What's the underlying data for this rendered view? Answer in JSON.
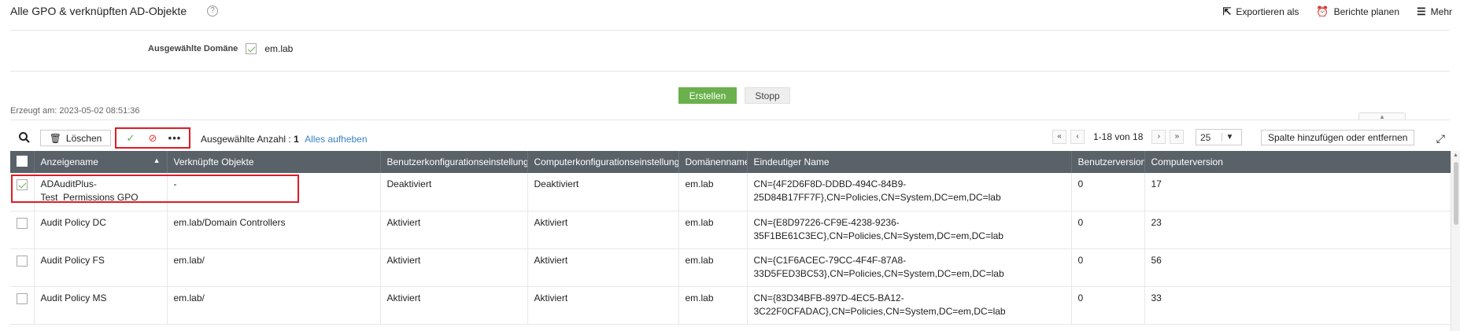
{
  "header": {
    "title": "Alle GPO & verknüpften AD-Objekte",
    "help_icon": "help-icon",
    "actions": [
      {
        "label": "Exportieren als",
        "icon": "export-icon"
      },
      {
        "label": "Berichte planen",
        "icon": "schedule-icon"
      },
      {
        "label": "Mehr",
        "icon": "more-menu-icon"
      }
    ]
  },
  "domain": {
    "label": "Ausgewählte Domäne",
    "value": "em.lab",
    "checked": true
  },
  "buttons": {
    "create": "Erstellen",
    "stop": "Stopp"
  },
  "generated": "Erzeugt am: 2023-05-02 08:51:36",
  "toolbar": {
    "delete": "Löschen",
    "selected_label": "Ausgewählte Anzahl :",
    "selected_count": "1",
    "clear_selection": "Alles aufheben",
    "page_info": "1-18 von 18",
    "page_size": "25",
    "columns_button": "Spalte hinzufügen oder entfernen"
  },
  "table": {
    "columns": [
      "Anzeigename",
      "Verknüpfte Objekte",
      "Benutzerkonfigurationseinstellungen",
      "Computerkonfigurationseinstellungen",
      "Domänenname",
      "Eindeutiger Name",
      "Benutzerversion",
      "Computerversion"
    ],
    "rows": [
      {
        "name": "ADAuditPlus-Test_Permissions GPO",
        "linked": "-",
        "user_cfg": "Deaktiviert",
        "comp_cfg": "Deaktiviert",
        "domain": "em.lab",
        "dn": "CN={4F2D6F8D-DDBD-494C-84B9-25D84B17FF7F},CN=Policies,CN=System,DC=em,DC=lab",
        "user_ver": "0",
        "comp_ver": "17",
        "checked": true
      },
      {
        "name": "Audit Policy DC",
        "linked": "em.lab/Domain Controllers",
        "user_cfg": "Aktiviert",
        "comp_cfg": "Aktiviert",
        "domain": "em.lab",
        "dn": "CN={E8D97226-CF9E-4238-9236-35F1BE61C3EC},CN=Policies,CN=System,DC=em,DC=lab",
        "user_ver": "0",
        "comp_ver": "23",
        "checked": false
      },
      {
        "name": "Audit Policy FS",
        "linked": "em.lab/",
        "user_cfg": "Aktiviert",
        "comp_cfg": "Aktiviert",
        "domain": "em.lab",
        "dn": "CN={C1F6ACEC-79CC-4F4F-87A8-33D5FED3BC53},CN=Policies,CN=System,DC=em,DC=lab",
        "user_ver": "0",
        "comp_ver": "56",
        "checked": false
      },
      {
        "name": "Audit Policy MS",
        "linked": "em.lab/",
        "user_cfg": "Aktiviert",
        "comp_cfg": "Aktiviert",
        "domain": "em.lab",
        "dn": "CN={83D34BFB-897D-4EC5-BA12-3C22F0CFADAC},CN=Policies,CN=System,DC=em,DC=lab",
        "user_ver": "0",
        "comp_ver": "33",
        "checked": false
      }
    ]
  }
}
